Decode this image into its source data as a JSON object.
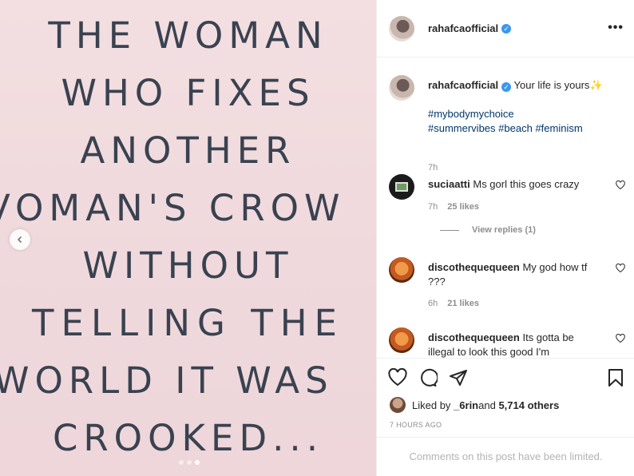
{
  "image": {
    "quote_lines": [
      "THE WOMAN",
      "WHO FIXES",
      "ANOTHER",
      "VOMAN'S CROW",
      "WITHOUT",
      "TELLING THE",
      "WORLD IT WAS",
      "CROOKED..."
    ],
    "carousel": {
      "current_slide": 2,
      "total_slides": 3
    }
  },
  "header": {
    "username": "rahafcaofficial",
    "verified_mark": "✓",
    "more_label": "•••"
  },
  "caption": {
    "username": "rahafcaofficial",
    "text": " Your life is yours",
    "emoji": "✨",
    "hashtags": {
      "line1": "#mybodymychoice",
      "line2_a": "#summervibes",
      "line2_b": "#beach",
      "line2_c": "#feminism"
    },
    "time": "7h"
  },
  "comments": [
    {
      "username": "suciaatti",
      "text": " Ms gorl this goes crazy",
      "time": "7h",
      "likes": "25 likes",
      "view_replies": "View replies (1)"
    },
    {
      "username": "discothequequeen",
      "text": " My god how tf ???",
      "time": "6h",
      "likes": "21 likes"
    },
    {
      "username": "discothequequeen",
      "text": " Its gotta be illegal to look this good I'm"
    }
  ],
  "actions": {
    "liked_by_prefix": "Liked by ",
    "liked_by_user": "_6rin",
    "liked_by_and": " and ",
    "liked_by_others": "5,714 others",
    "timestamp": "7 HOURS AGO",
    "comments_limited": "Comments on this post have been limited."
  },
  "icons": {
    "heart": "heart-icon",
    "comment": "comment-icon",
    "share": "share-icon",
    "bookmark": "bookmark-icon",
    "more": "more-icon",
    "prev": "chevron-left-icon"
  },
  "colors": {
    "accent": "#3897f0",
    "hashtag": "#00376b",
    "muted": "#8e8e8e",
    "image_bg": "#f1dcdf",
    "quote_text": "#3a4250"
  }
}
